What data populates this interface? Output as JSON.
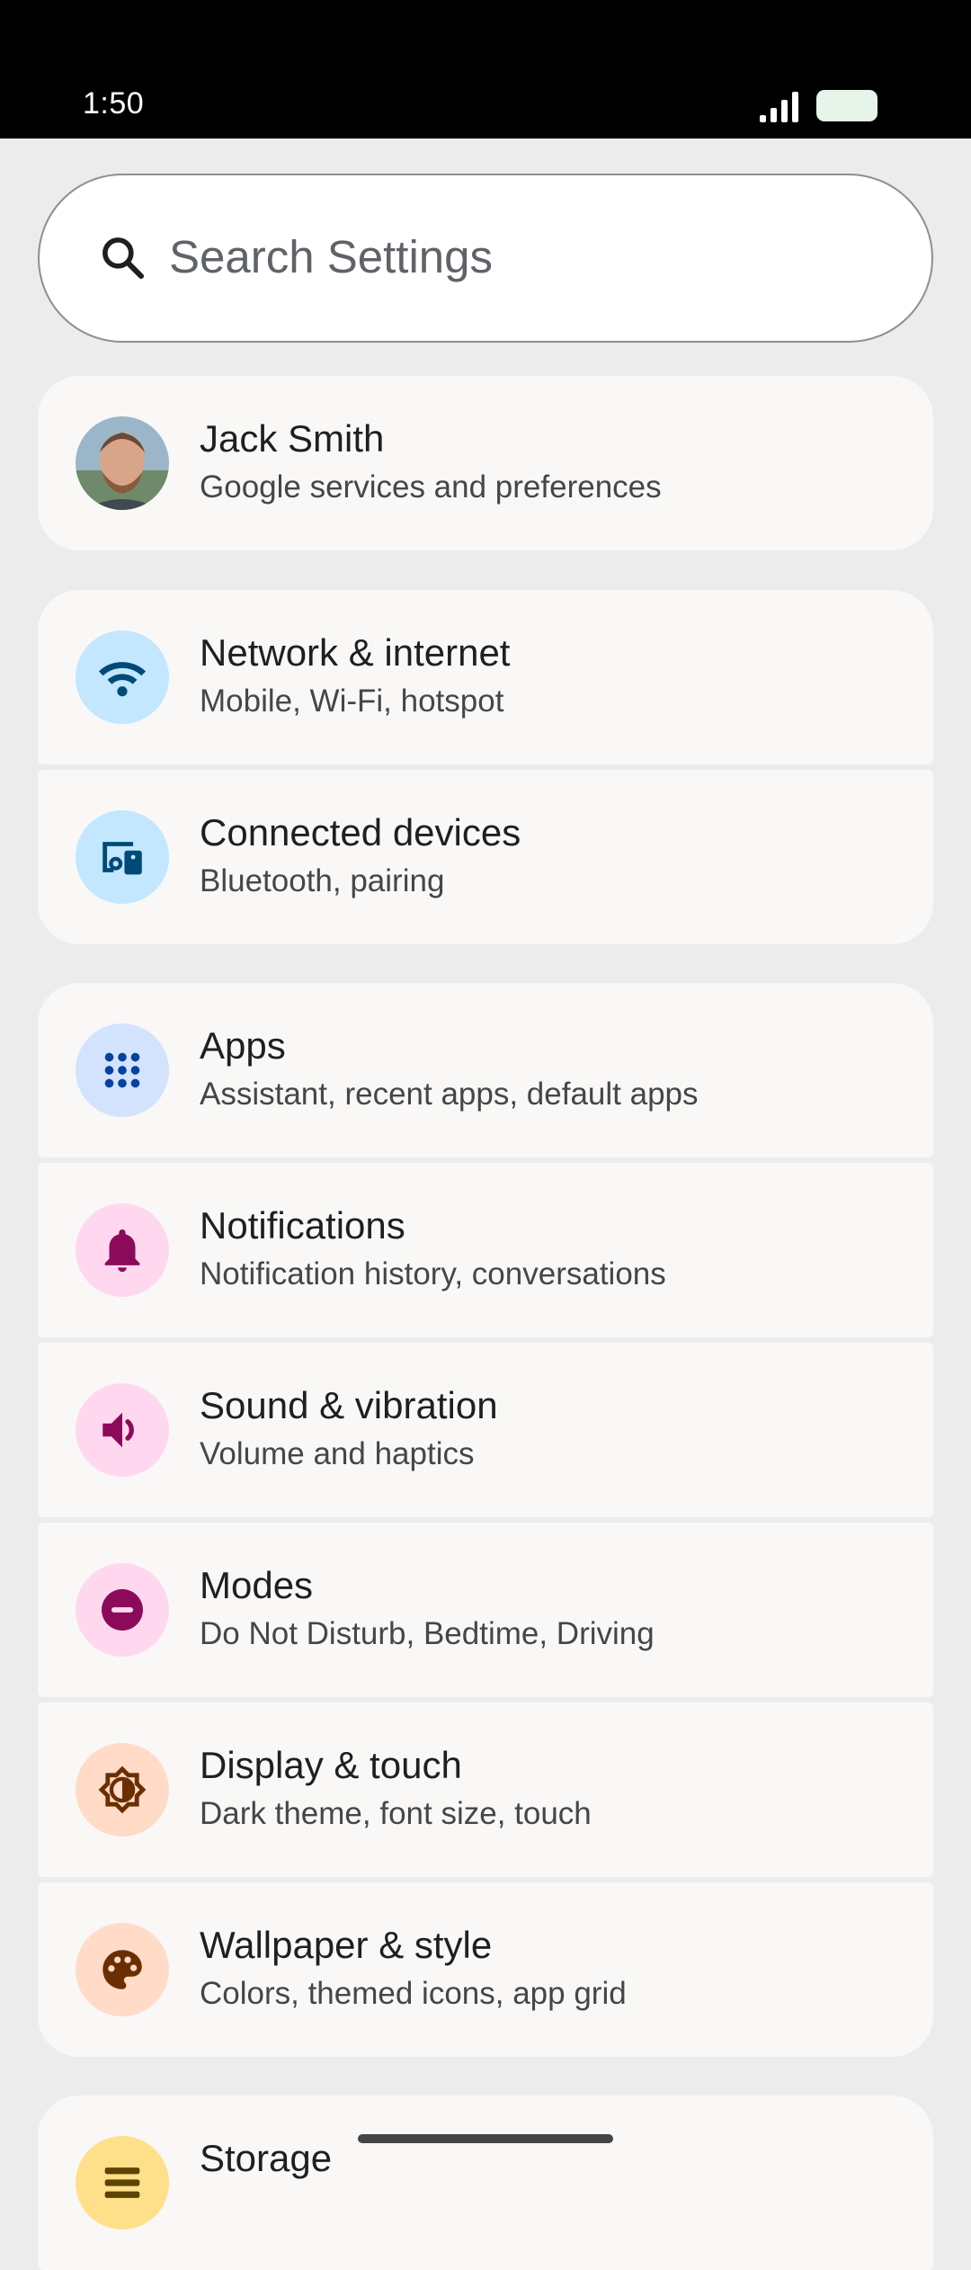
{
  "status_bar": {
    "time": "1:50"
  },
  "search": {
    "placeholder": "Search Settings"
  },
  "account": {
    "name": "Jack Smith",
    "subtitle": "Google services and preferences"
  },
  "items": [
    {
      "title": "Network & internet",
      "subtitle": "Mobile, Wi-Fi, hotspot",
      "icon": "wifi-icon",
      "bg": "#c2e7ff",
      "fg": "#004a77"
    },
    {
      "title": "Connected devices",
      "subtitle": "Bluetooth, pairing",
      "icon": "devices-icon",
      "bg": "#c2e7ff",
      "fg": "#004a77"
    },
    {
      "title": "Apps",
      "subtitle": "Assistant, recent apps, default apps",
      "icon": "apps-grid-icon",
      "bg": "#d3e3fd",
      "fg": "#0842a0"
    },
    {
      "title": "Notifications",
      "subtitle": "Notification history, conversations",
      "icon": "bell-icon",
      "bg": "#ffd8f0",
      "fg": "#8c0a5a"
    },
    {
      "title": "Sound & vibration",
      "subtitle": "Volume and haptics",
      "icon": "speaker-icon",
      "bg": "#ffd8f0",
      "fg": "#8c0a5a"
    },
    {
      "title": "Modes",
      "subtitle": "Do Not Disturb, Bedtime, Driving",
      "icon": "do-not-disturb-icon",
      "bg": "#ffd8f0",
      "fg": "#8c0a5a"
    },
    {
      "title": "Display & touch",
      "subtitle": "Dark theme, font size, touch",
      "icon": "brightness-icon",
      "bg": "#ffdbc8",
      "fg": "#6b2e00"
    },
    {
      "title": "Wallpaper & style",
      "subtitle": "Colors, themed icons, app grid",
      "icon": "palette-icon",
      "bg": "#ffdbc8",
      "fg": "#6b2e00"
    },
    {
      "title": "Storage",
      "subtitle": "",
      "icon": "storage-icon",
      "bg": "#ffe08a",
      "fg": "#5c4300"
    }
  ]
}
